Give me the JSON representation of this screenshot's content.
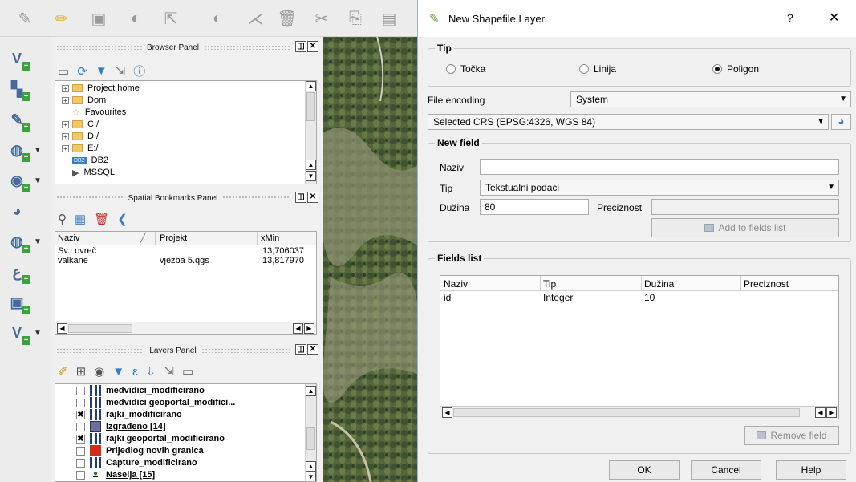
{
  "browser_panel": {
    "title": "Browser Panel",
    "items": [
      {
        "label": "Project home",
        "expander": "+"
      },
      {
        "label": "Dom",
        "expander": "+"
      },
      {
        "label": "Favourites",
        "expander": ""
      },
      {
        "label": "C:/",
        "expander": "+"
      },
      {
        "label": "D:/",
        "expander": "+"
      },
      {
        "label": "E:/",
        "expander": "+"
      },
      {
        "label": "DB2",
        "expander": "",
        "badge": "DB2"
      },
      {
        "label": "MSSQL",
        "expander": ""
      }
    ]
  },
  "bookmarks_panel": {
    "title": "Spatial Bookmarks Panel",
    "columns": [
      "Naziv",
      "Projekt",
      "xMin"
    ],
    "rows": [
      {
        "naziv": "Sv.Lovreč",
        "projekt": "",
        "xmin": "13,706037"
      },
      {
        "naziv": "valkane",
        "projekt": "vjezba 5.qgs",
        "xmin": "13,817970"
      }
    ]
  },
  "layers_panel": {
    "title": "Layers Panel",
    "layers": [
      {
        "label": "medvidici_modificirano",
        "checked": false,
        "underline": false
      },
      {
        "label": "medvidici geoportal_modifici...",
        "checked": false,
        "underline": false
      },
      {
        "label": "rajki_modificirano",
        "checked": true,
        "underline": false
      },
      {
        "label": "Izgrađeno [14]",
        "checked": false,
        "underline": true
      },
      {
        "label": "rajki geoportal_modificirano",
        "checked": true,
        "underline": false
      },
      {
        "label": "Prijedlog novih granica",
        "checked": false,
        "underline": false
      },
      {
        "label": "Capture_modificirano",
        "checked": false,
        "underline": false
      },
      {
        "label": "Naselja [15]",
        "checked": false,
        "underline": true
      }
    ]
  },
  "dialog": {
    "title": "New Shapefile Layer",
    "help_btn": "?",
    "close_btn": "✕",
    "tip_group": "Tip",
    "radios": [
      {
        "label": "Točka",
        "selected": false
      },
      {
        "label": "Linija",
        "selected": false
      },
      {
        "label": "Poligon",
        "selected": true
      }
    ],
    "file_encoding_label": "File encoding",
    "file_encoding_value": "System",
    "crs_value": "Selected CRS (EPSG:4326, WGS 84)",
    "new_field_group": "New field",
    "naziv_label": "Naziv",
    "naziv_value": "",
    "tip_label": "Tip",
    "tip_value": "Tekstualni podaci",
    "duzina_label": "Dužina",
    "duzina_value": "80",
    "preciznost_label": "Preciznost",
    "preciznost_value": "",
    "add_btn": "Add to fields list",
    "fields_group": "Fields list",
    "fields_columns": [
      "Naziv",
      "Tip",
      "Dužina",
      "Preciznost"
    ],
    "fields_rows": [
      {
        "naziv": "id",
        "tip": "Integer",
        "duzina": "10",
        "preciznost": ""
      }
    ],
    "remove_btn": "Remove field",
    "ok_btn": "OK",
    "cancel_btn": "Cancel",
    "help_button": "Help"
  },
  "colors": {
    "dialog_accent": "#5aa02c",
    "layer_izgradeno": "#6b6fa3",
    "layer_prijedlog": "#d42a1a",
    "map_green": "#5b6c43"
  }
}
